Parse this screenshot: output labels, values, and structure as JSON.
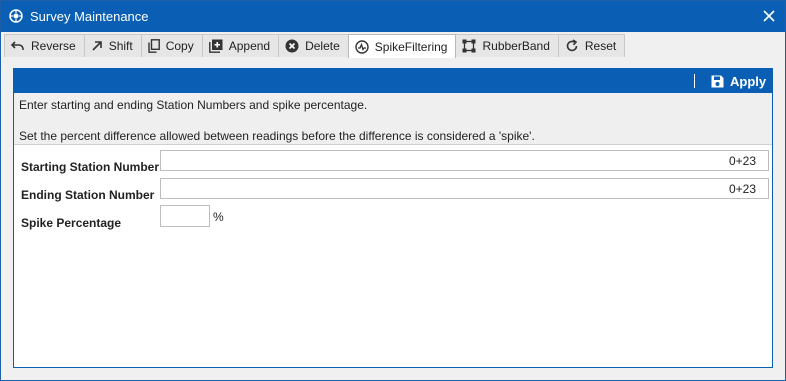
{
  "window": {
    "title": "Survey Maintenance"
  },
  "tabs": [
    {
      "label": "Reverse",
      "icon": "undo-icon"
    },
    {
      "label": "Shift",
      "icon": "arrow-up-right-icon"
    },
    {
      "label": "Copy",
      "icon": "copy-icon"
    },
    {
      "label": "Append",
      "icon": "add-square-icon"
    },
    {
      "label": "Delete",
      "icon": "delete-circle-icon"
    },
    {
      "label": "SpikeFiltering",
      "icon": "spike-filter-icon",
      "active": true
    },
    {
      "label": "RubberBand",
      "icon": "rubberband-icon"
    },
    {
      "label": "Reset",
      "icon": "refresh-icon"
    }
  ],
  "toolbar": {
    "apply_label": "Apply"
  },
  "info": {
    "line1": "Enter starting and ending Station Numbers and spike percentage.",
    "line2": "Set the percent difference allowed between readings before the difference is considered a 'spike'."
  },
  "form": {
    "starting_label": "Starting Station Number",
    "starting_value": "0+23",
    "ending_label": "Ending Station Number",
    "ending_value": "0+23",
    "spike_label": "Spike Percentage",
    "spike_value": "",
    "spike_unit": "%"
  },
  "colors": {
    "accent": "#0a5fb4"
  }
}
